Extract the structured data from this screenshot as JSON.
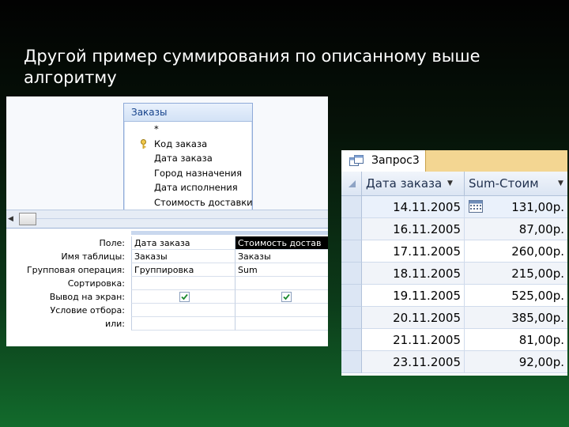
{
  "slide": {
    "title": "Другой пример суммирования по описанному выше алгоритму"
  },
  "designer": {
    "table": {
      "name": "Заказы",
      "fields": [
        "*",
        "Код заказа",
        "Дата заказа",
        "Город назначения",
        "Дата исполнения",
        "Стоимость доставки"
      ]
    },
    "grid": {
      "row_labels": [
        "Поле:",
        "Имя таблицы:",
        "Групповая операция:",
        "Сортировка:",
        "Вывод на экран:",
        "Условие отбора:",
        "или:"
      ],
      "columns": [
        {
          "field": "Дата заказа",
          "table": "Заказы",
          "group": "Группировка",
          "show": true
        },
        {
          "field": "Стоимость достав",
          "table": "Заказы",
          "group": "Sum",
          "show": true
        }
      ]
    }
  },
  "result": {
    "tab_label": "Запрос3",
    "headers": {
      "date": "Дата заказа",
      "sum": "Sum-Стоим"
    },
    "rows": [
      {
        "date": "14.11.2005",
        "sum": "131,00р."
      },
      {
        "date": "16.11.2005",
        "sum": "87,00р."
      },
      {
        "date": "17.11.2005",
        "sum": "260,00р."
      },
      {
        "date": "18.11.2005",
        "sum": "215,00р."
      },
      {
        "date": "19.11.2005",
        "sum": "525,00р."
      },
      {
        "date": "20.11.2005",
        "sum": "385,00р."
      },
      {
        "date": "21.11.2005",
        "sum": "81,00р."
      },
      {
        "date": "23.11.2005",
        "sum": "92,00р."
      }
    ]
  },
  "colors": {
    "background_top": "#020202",
    "background_bottom": "#126b2c",
    "tab_bar": "#f3d692",
    "table_title": "#15428b"
  },
  "icons": [
    "key-icon",
    "query-icon",
    "calendar-icon",
    "dropdown-arrow-icon",
    "checkbox-checked-icon"
  ]
}
